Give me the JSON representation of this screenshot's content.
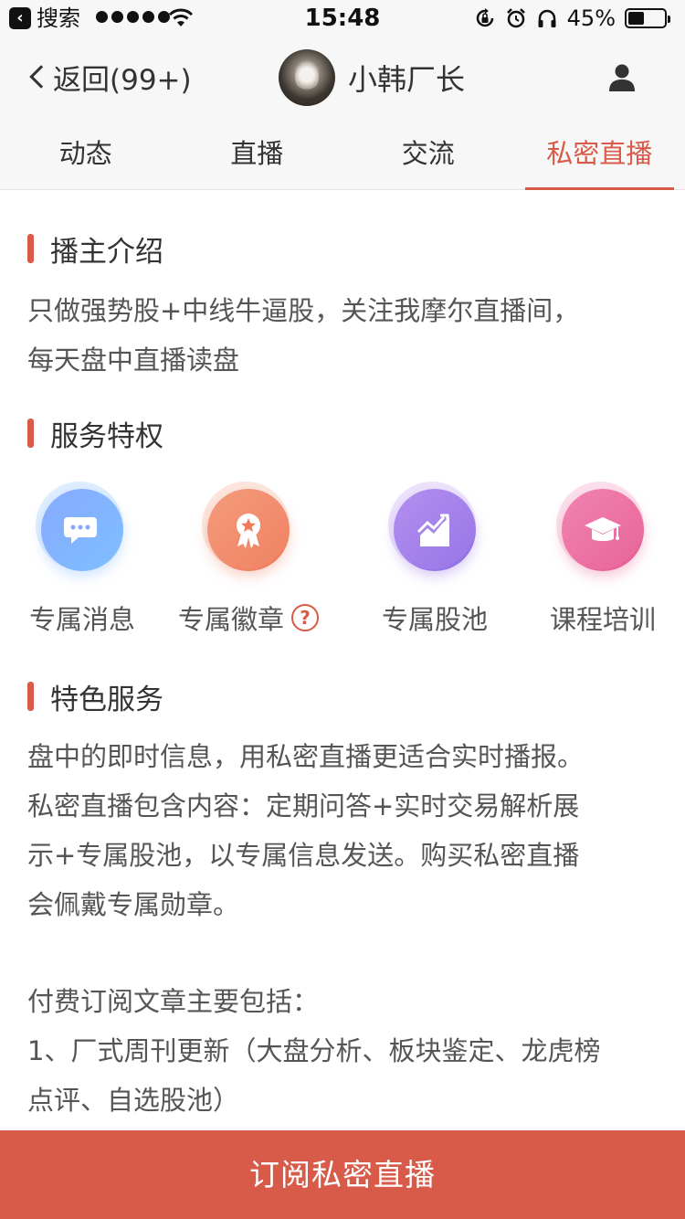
{
  "status_bar": {
    "back_app": "搜索",
    "time": "15:48",
    "battery_pct": "45%",
    "battery_level": 0.45,
    "icons": [
      "signal-dots-icon",
      "wifi-icon",
      "rotation-lock-icon",
      "alarm-icon",
      "headphones-icon",
      "battery-icon"
    ]
  },
  "nav": {
    "back_label": "返回(99+)",
    "user_name": "小韩厂长",
    "profile_icon": "person-icon"
  },
  "tabs": [
    {
      "label": "动态",
      "active": false
    },
    {
      "label": "直播",
      "active": false
    },
    {
      "label": "交流",
      "active": false
    },
    {
      "label": "私密直播",
      "active": true
    }
  ],
  "sections": {
    "intro": {
      "title": "播主介绍",
      "lines": [
        "只做强势股+中线牛逼股，关注我摩尔直播间，",
        "每天盘中直播读盘"
      ]
    },
    "privileges": {
      "title": "服务特权",
      "items": [
        {
          "label": "专属消息",
          "icon": "chat-bubble-icon"
        },
        {
          "label": "专属徽章",
          "icon": "badge-medal-icon",
          "help": "?"
        },
        {
          "label": "专属股池",
          "icon": "stock-chart-icon"
        },
        {
          "label": "课程培训",
          "icon": "graduation-cap-icon"
        }
      ]
    },
    "features": {
      "title": "特色服务",
      "lines": [
        "盘中的即时信息，用私密直播更适合实时播报。",
        "私密直播包含内容：定期问答+实时交易解析展",
        "示+专属股池，以专属信息发送。购买私密直播",
        "会佩戴专属勋章。"
      ],
      "lines2": [
        "付费订阅文章主要包括：",
        "1、厂式周刊更新（大盘分析、板块鉴定、龙虎榜",
        "点评、自选股池）"
      ]
    }
  },
  "subscribe_label": "订阅私密直播",
  "colors": {
    "accent": "#d85a48",
    "text": "#333333",
    "body_text": "#555555"
  }
}
